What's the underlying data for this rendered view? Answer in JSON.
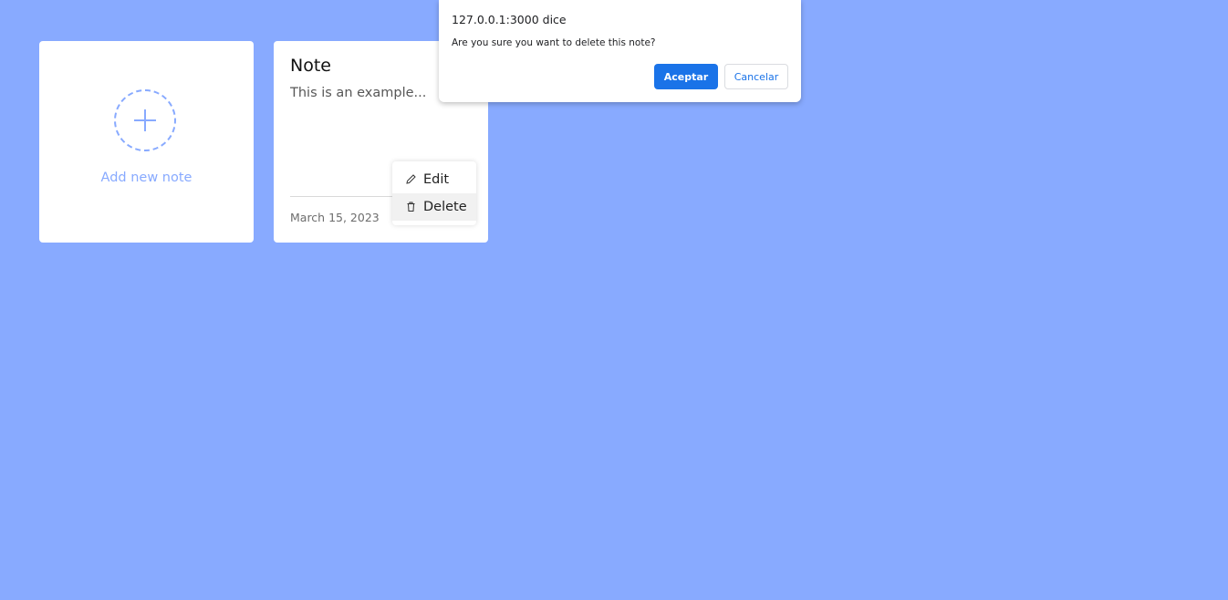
{
  "add_card": {
    "label": "Add new note",
    "icon": "plus-icon"
  },
  "note": {
    "title": "Note",
    "description": "This is an example...",
    "date": "March 15, 2023"
  },
  "menu": {
    "edit_label": "Edit",
    "delete_label": "Delete",
    "edit_icon": "pencil-icon",
    "delete_icon": "trash-icon"
  },
  "dialog": {
    "origin": "127.0.0.1:3000 dice",
    "message": "Are you sure you want to delete this note?",
    "accept_label": "Aceptar",
    "cancel_label": "Cancelar"
  },
  "colors": {
    "background": "#88aaff",
    "accent": "#1a73e8"
  }
}
